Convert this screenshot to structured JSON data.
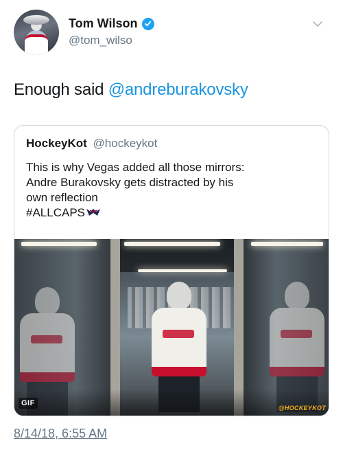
{
  "tweet": {
    "author": {
      "display_name": "Tom Wilson",
      "handle": "@tom_wilso",
      "verified": true,
      "avatar_icon": "avatar-photo"
    },
    "menu_icon": "chevron-down-icon",
    "text_plain": "Enough said ",
    "text_mention": "@andreburakovsky",
    "timestamp": "8/14/18, 6:55 AM"
  },
  "quoted_tweet": {
    "display_name": "HockeyKot",
    "handle": "@hockeykot",
    "lines": [
      "This is why Vegas added all those mirrors:",
      "Andre Burakovsky gets distracted by his",
      "own reflection",
      "#ALLCAPS"
    ],
    "hashtag_icon": "capitals-eagle-icon",
    "media": {
      "badge": "GIF",
      "watermark": "@HOCKEYKOT"
    }
  },
  "colors": {
    "link": "#1b95e0",
    "verified": "#1da1f2",
    "secondary_text": "#657786",
    "border": "#ccd6dd"
  }
}
